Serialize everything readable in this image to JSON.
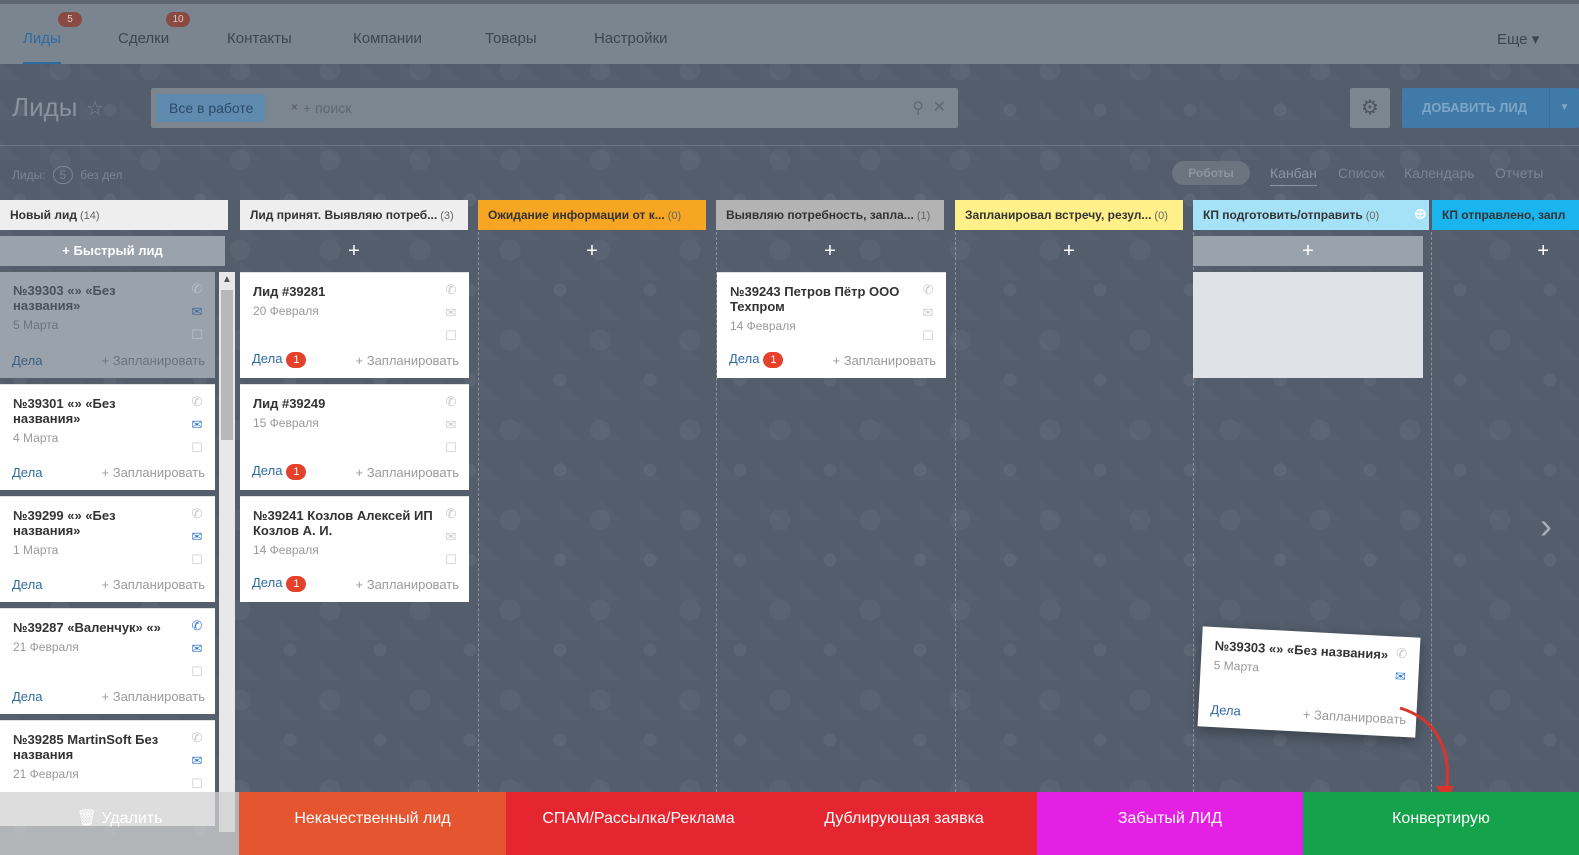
{
  "nav": {
    "items": [
      {
        "label": "Лиды",
        "badge": "5"
      },
      {
        "label": "Сделки",
        "badge": "10"
      },
      {
        "label": "Контакты"
      },
      {
        "label": "Компании"
      },
      {
        "label": "Товары"
      },
      {
        "label": "Настройки"
      }
    ],
    "more": "Еще"
  },
  "header": {
    "title": "Лиды",
    "filter_chip": "Все в работе",
    "search_placeholder": "+ поиск",
    "add_button": "ДОБАВИТЬ ЛИД"
  },
  "subheader": {
    "leads_label": "Лиды:",
    "leads_count": "5",
    "no_tasks": "без дел",
    "robots": "Роботы",
    "views": [
      "Канбан",
      "Список",
      "Календарь",
      "Отчеты"
    ]
  },
  "columns": [
    {
      "title": "Новый лид",
      "count": "(14)",
      "color": "#eeeeee"
    },
    {
      "title": "Лид принят. Выявляю потреб...",
      "count": "(3)",
      "color": "#eeeeee"
    },
    {
      "title": "Ожидание информации от к...",
      "count": "(0)",
      "color": "#f6a623"
    },
    {
      "title": "Выявляю потребность, запла...",
      "count": "(1)",
      "color": "#b3b3b3"
    },
    {
      "title": "Запланировал встречу, резул...",
      "count": "(0)",
      "color": "#fff08a"
    },
    {
      "title": "КП подготовить/отправить",
      "count": "(0)",
      "color": "#a6e2f7"
    },
    {
      "title": "КП отправлено, запл",
      "count": "",
      "color": "#1ab5ee"
    }
  ],
  "quick_lead": "+ Быстрый лид",
  "card_common": {
    "tasks": "Дела",
    "plan": "+ Запланировать"
  },
  "col1_cards": [
    {
      "title": "№39303 «» «Без названия»",
      "date": "5 Марта"
    },
    {
      "title": "№39301 «» «Без названия»",
      "date": "4 Марта"
    },
    {
      "title": "№39299 «» «Без названия»",
      "date": "1 Марта"
    },
    {
      "title": "№39287 «Валенчук» «»",
      "date": "21 Февраля"
    },
    {
      "title": "№39285 MartinSoft Без названия",
      "date": "21 Февраля"
    }
  ],
  "col2_cards": [
    {
      "title": "Лид #39281",
      "date": "20 Февраля",
      "badge": "1"
    },
    {
      "title": "Лид #39249",
      "date": "15 Февраля",
      "badge": "1"
    },
    {
      "title": "№39241 Козлов Алексей ИП Козлов А. И.",
      "date": "14 Февраля",
      "badge": "1"
    }
  ],
  "col4_cards": [
    {
      "title": "№39243 Петров Пётр ООО Техпром",
      "date": "14 Февраля",
      "badge": "1"
    }
  ],
  "drag_card": {
    "title": "№39303 «» «Без названия»",
    "date": "5 Марта"
  },
  "actions": {
    "delete": "Удалить",
    "bad_lead": "Некачественный лид",
    "spam": "СПАМ/Рассылка/Реклама",
    "duplicate": "Дублирующая заявка",
    "forgotten": "Забытый ЛИД",
    "convert": "Конвертирую"
  },
  "colors": {
    "bad_lead": "#e55530",
    "spam": "#e5252f",
    "duplicate": "#e5252f",
    "forgotten": "#e520e5",
    "convert": "#14a24a",
    "link": "#2f6aa4",
    "accent": "#3f7aa8"
  }
}
